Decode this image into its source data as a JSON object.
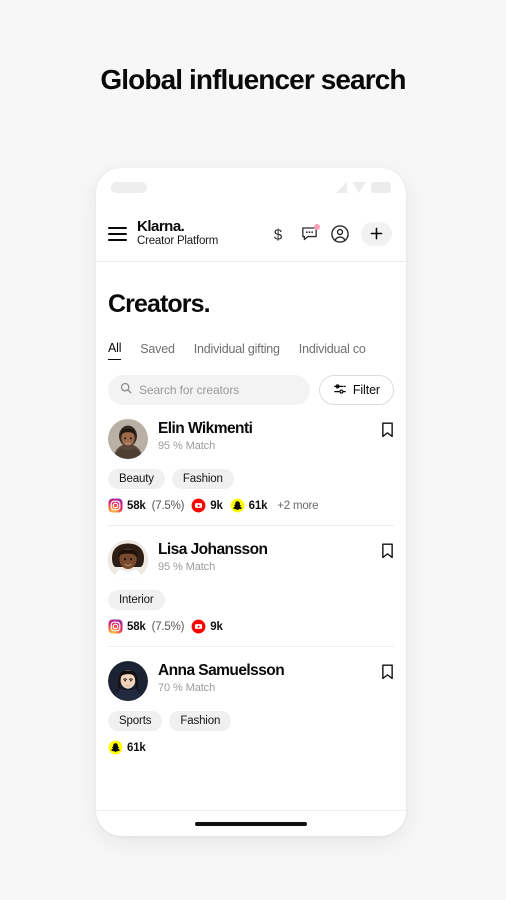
{
  "headline": "Global influencer search",
  "phone": {
    "statusbar": {
      "left_placeholder": "",
      "signal_icon": "signal-icon",
      "wifi_icon": "wifi-icon",
      "battery_icon": "battery-icon"
    },
    "header": {
      "menu_icon": "hamburger-menu-icon",
      "brand_name": "Klarna.",
      "brand_subtitle": "Creator Platform",
      "actions": [
        {
          "name": "dollar-icon",
          "label": "$"
        },
        {
          "name": "messages-icon",
          "label": "",
          "badge": true
        },
        {
          "name": "account-icon",
          "label": ""
        }
      ],
      "add_button_label": "+"
    },
    "screen": {
      "page_title": "Creators.",
      "tabs": [
        {
          "label": "All",
          "active": true
        },
        {
          "label": "Saved",
          "active": false
        },
        {
          "label": "Individual gifting",
          "active": false
        },
        {
          "label": "Individual co",
          "active": false
        }
      ],
      "search": {
        "placeholder": "Search for creators",
        "value": "",
        "icon": "search-icon"
      },
      "filter": {
        "label": "Filter",
        "icon": "sliders-icon"
      },
      "creators": [
        {
          "name": "Elin Wikmenti",
          "match": "95 % Match",
          "bookmark_icon": "bookmark-icon",
          "tags": [
            "Beauty",
            "Fashion"
          ],
          "stats": [
            {
              "platform": "instagram",
              "value": "58k",
              "pct": "(7.5%)"
            },
            {
              "platform": "youtube",
              "value": "9k",
              "pct": ""
            },
            {
              "platform": "snapchat",
              "value": "61k",
              "pct": ""
            }
          ],
          "more": "+2 more"
        },
        {
          "name": "Lisa Johansson",
          "match": "95 % Match",
          "bookmark_icon": "bookmark-icon",
          "tags": [
            "Interior"
          ],
          "stats": [
            {
              "platform": "instagram",
              "value": "58k",
              "pct": "(7.5%)"
            },
            {
              "platform": "youtube",
              "value": "9k",
              "pct": ""
            }
          ],
          "more": ""
        },
        {
          "name": "Anna Samuelsson",
          "match": "70 % Match",
          "bookmark_icon": "bookmark-icon",
          "tags": [
            "Sports",
            "Fashion"
          ],
          "stats": [
            {
              "platform": "snapchat",
              "value": "61k",
              "pct": ""
            }
          ],
          "more": ""
        }
      ]
    },
    "home_indicator": "home-indicator"
  },
  "colors": {
    "page_background": "#f7f7f7",
    "text_primary": "#0a0a0a",
    "text_muted": "#9b9b9b",
    "tag_background": "#f0f0f0",
    "search_background": "#f3f3f3",
    "notification_dot": "#ff9eb5",
    "snapchat_yellow": "#fffc00",
    "youtube_red": "#ff0000",
    "divider": "#ededed"
  }
}
